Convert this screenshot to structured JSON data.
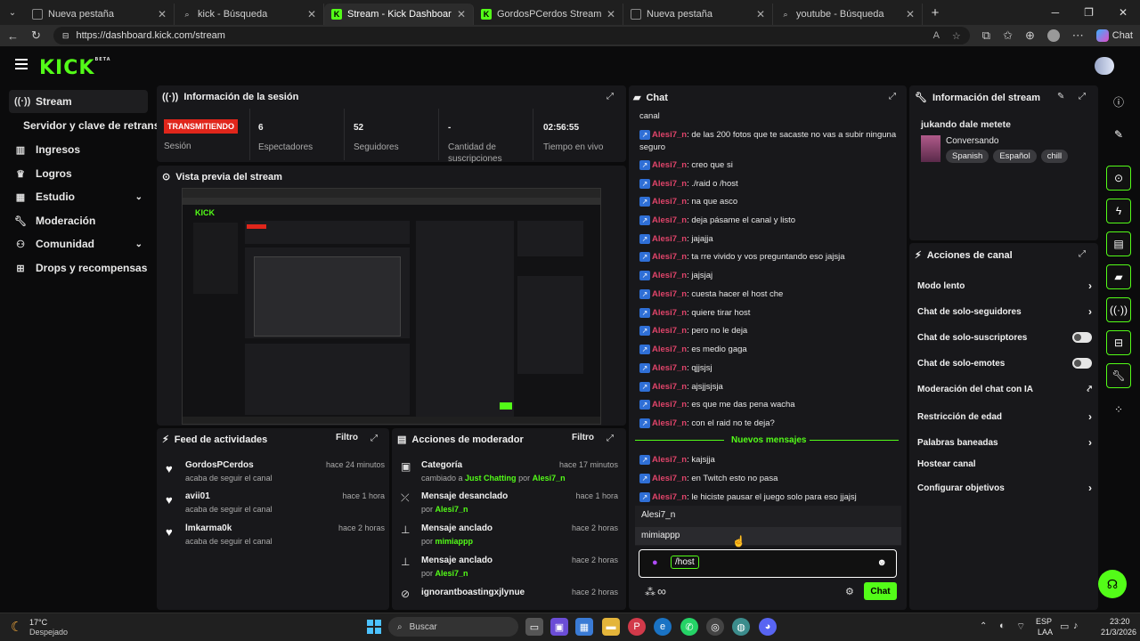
{
  "browser": {
    "tabs": [
      {
        "title": "Nueva pestaña",
        "icon": "page-icon"
      },
      {
        "title": "kick - Búsqueda",
        "icon": "search-icon"
      },
      {
        "title": "Stream - Kick Dashboard",
        "icon": "kick-icon"
      },
      {
        "title": "GordosPCerdos Stream - Watch Li",
        "icon": "kick-icon"
      },
      {
        "title": "Nueva pestaña",
        "icon": "page-icon"
      },
      {
        "title": "youtube - Búsqueda",
        "icon": "search-icon"
      }
    ],
    "url": "https://dashboard.kick.com/stream",
    "chat_label": "Chat"
  },
  "logo": "KICK",
  "logo_sup": "BETA",
  "sidebar": {
    "items": [
      {
        "label": "Stream",
        "icon": "stream-icon"
      },
      {
        "label": "Servidor y clave de retransmisión"
      },
      {
        "label": "Ingresos",
        "icon": "bar-chart-icon"
      },
      {
        "label": "Logros",
        "icon": "trophy-icon"
      },
      {
        "label": "Estudio",
        "icon": "grid-icon"
      },
      {
        "label": "Moderación",
        "icon": "wrench-icon"
      },
      {
        "label": "Comunidad",
        "icon": "people-icon"
      },
      {
        "label": "Drops y recompensas",
        "icon": "gift-icon"
      }
    ]
  },
  "session": {
    "title": "Información de la sesión",
    "live": "TRANSMITIENDO",
    "session_label": "Sesión",
    "viewers": "6",
    "viewers_label": "Espectadores",
    "followers": "52",
    "followers_label": "Seguidores",
    "subs": "-",
    "subs_label": "Cantidad de suscripciones",
    "time": "02:56:55",
    "time_label": "Tiempo en vivo"
  },
  "preview": {
    "title": "Vista previa del stream"
  },
  "feed": {
    "title": "Feed de actividades",
    "filter": "Filtro",
    "items": [
      {
        "name": "GordosPCerdos",
        "sub": "acaba de seguir el canal",
        "time": "hace 24 minutos"
      },
      {
        "name": "avii01",
        "sub": "acaba de seguir el canal",
        "time": "hace 1 hora"
      },
      {
        "name": "lmkarma0k",
        "sub": "acaba de seguir el canal",
        "time": "hace 2 horas"
      }
    ]
  },
  "mod": {
    "title": "Acciones de moderador",
    "filter": "Filtro",
    "items": [
      {
        "name": "Categoría",
        "pre": "cambiado a",
        "hl": "Just Chatting",
        "mid": "por",
        "user": "Alesi7_n",
        "time": "hace 17 minutos"
      },
      {
        "name": "Mensaje desanclado",
        "pre": "por",
        "user": "Alesi7_n",
        "time": "hace 1 hora"
      },
      {
        "name": "Mensaje anclado",
        "pre": "por",
        "user": "mimiappp",
        "time": "hace 2 horas"
      },
      {
        "name": "Mensaje anclado",
        "pre": "por",
        "user": "Alesi7_n",
        "time": "hace 2 horas"
      },
      {
        "name": "ignorantboastingxjlynue",
        "pre": "",
        "user": "",
        "time": "hace 2 horas"
      }
    ]
  },
  "chat": {
    "title": "Chat",
    "top_text": "canal",
    "messages": [
      {
        "user": "Alesi7_n",
        "text": ": de las 200 fotos que te sacaste no vas a subir ninguna seguro"
      },
      {
        "user": "Alesi7_n",
        "text": ": creo que si"
      },
      {
        "user": "Alesi7_n",
        "text": ": ./raid o /host"
      },
      {
        "user": "Alesi7_n",
        "text": ": na que asco"
      },
      {
        "user": "Alesi7_n",
        "text": ": deja pásame el canal y listo"
      },
      {
        "user": "Alesi7_n",
        "text": ": jajajja"
      },
      {
        "user": "Alesi7_n",
        "text": ": ta rre vivido y vos preguntando eso jajsja"
      },
      {
        "user": "Alesi7_n",
        "text": ": jajsjaj"
      },
      {
        "user": "Alesi7_n",
        "text": ": cuesta hacer el host che"
      },
      {
        "user": "Alesi7_n",
        "text": ": quiere tirar host"
      },
      {
        "user": "Alesi7_n",
        "text": ": pero no le deja"
      },
      {
        "user": "Alesi7_n",
        "text": ": es medio gaga"
      },
      {
        "user": "Alesi7_n",
        "text": ": qjjsjsj"
      },
      {
        "user": "Alesi7_n",
        "text": ": ajsjjsjsja"
      },
      {
        "user": "Alesi7_n",
        "text": ": es que me das pena wacha"
      },
      {
        "user": "Alesi7_n",
        "text": ": con el raid no te deja?"
      }
    ],
    "new_label": "Nuevos mensajes",
    "new_messages": [
      {
        "user": "Alesi7_n",
        "text": ": kajsjja"
      },
      {
        "user": "Alesi7_n",
        "text": ": en Twitch esto no pasa"
      },
      {
        "user": "Alesi7_n",
        "text": ": le hiciste pausar el juego solo para eso jjajsj"
      }
    ],
    "suggestions": [
      "Alesi7_n",
      "mimiappp"
    ],
    "input_value": "/host",
    "send": "Chat"
  },
  "stream_info": {
    "title": "Información del stream",
    "stream_title": "jukando dale metete",
    "category": "Conversando",
    "tags": [
      "Spanish",
      "Español",
      "chill"
    ]
  },
  "channel_actions": {
    "title": "Acciones de canal",
    "items": [
      {
        "label": "Modo lento",
        "ctl": "chevron"
      },
      {
        "label": "Chat de solo-seguidores",
        "ctl": "chevron"
      },
      {
        "label": "Chat de solo-suscriptores",
        "ctl": "toggle"
      },
      {
        "label": "Chat de solo-emotes",
        "ctl": "toggle"
      },
      {
        "label": "Moderación del chat con IA",
        "ctl": "external"
      },
      {
        "label": "Restricción de edad",
        "ctl": "chevron"
      },
      {
        "label": "Palabras baneadas",
        "ctl": "chevron"
      },
      {
        "label": "Hostear canal",
        "ctl": "none"
      },
      {
        "label": "Configurar objetivos",
        "ctl": "chevron"
      }
    ]
  },
  "taskbar": {
    "weather_temp": "17°C",
    "weather_desc": "Despejado",
    "search": "Buscar",
    "lang": "ESP",
    "lang2": "LAA",
    "time": "23:20",
    "date": "21/3/2026"
  },
  "colors": {
    "accent": "#53fc18",
    "live": "#e0261b",
    "username": "#e0446a"
  }
}
